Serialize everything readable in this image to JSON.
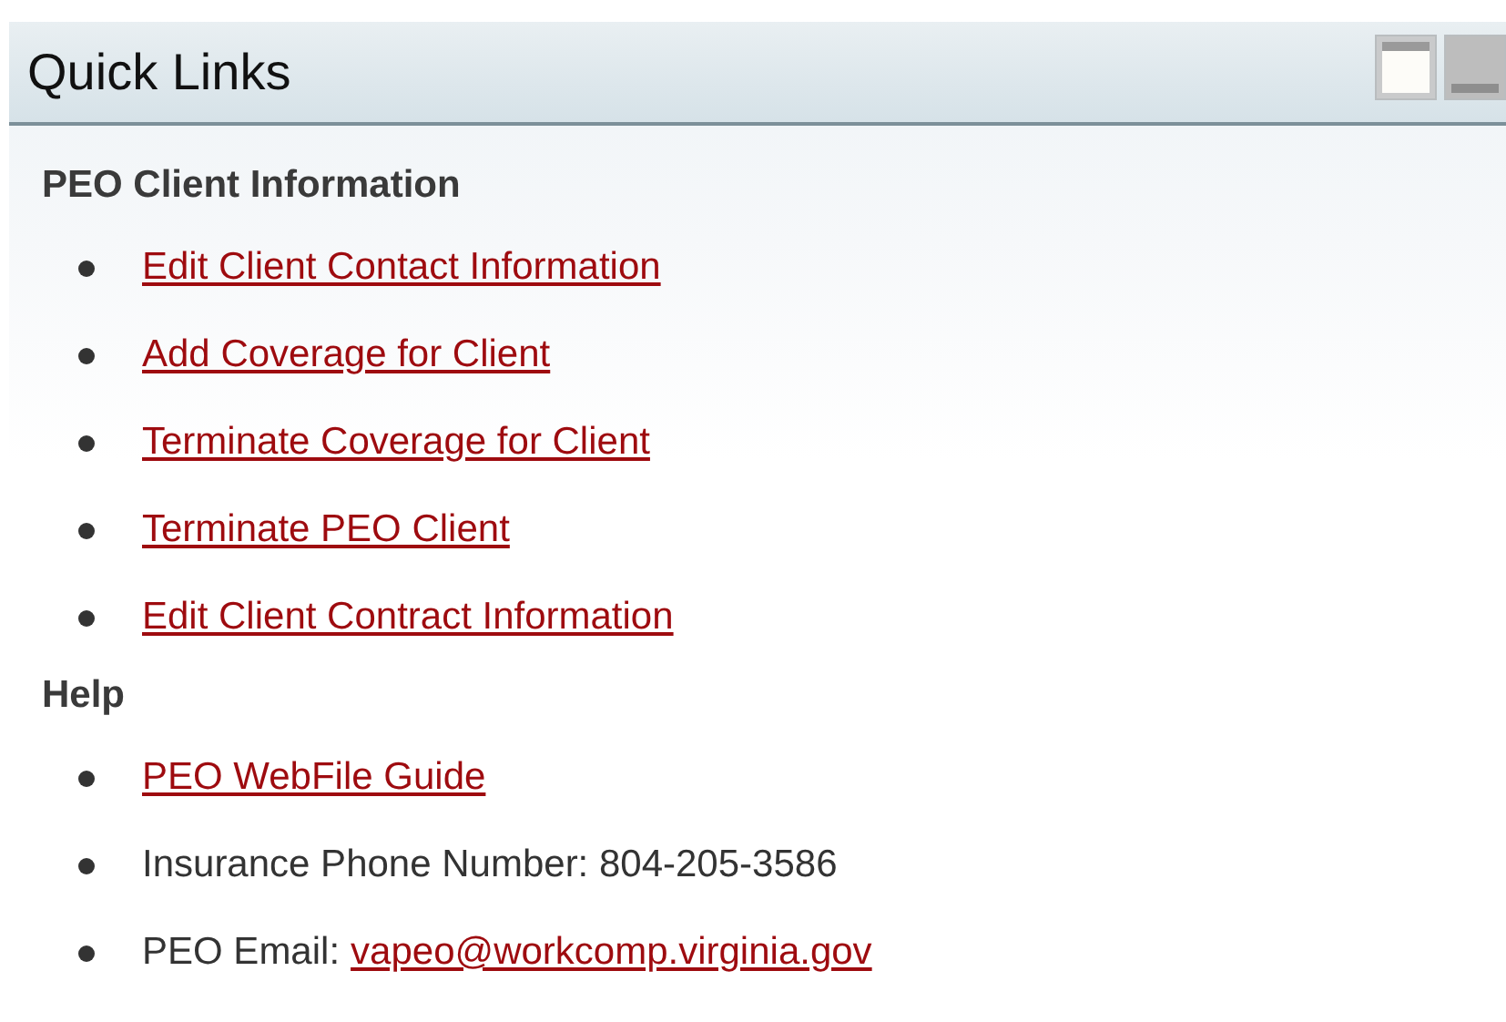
{
  "panel": {
    "title": "Quick Links"
  },
  "sections": [
    {
      "heading": "PEO Client Information",
      "items": [
        {
          "kind": "link",
          "link": "Edit Client Contact Information"
        },
        {
          "kind": "link",
          "link": "Add Coverage for Client"
        },
        {
          "kind": "link",
          "link": "Terminate Coverage for Client"
        },
        {
          "kind": "link",
          "link": "Terminate PEO Client"
        },
        {
          "kind": "link",
          "link": "Edit Client Contract Information"
        }
      ]
    },
    {
      "heading": "Help",
      "items": [
        {
          "kind": "link",
          "link": "PEO WebFile Guide"
        },
        {
          "kind": "text",
          "text": "Insurance Phone Number: 804-205-3586"
        },
        {
          "kind": "label_link",
          "text": "PEO Email:",
          "link": "vapeo@workcomp.virginia.gov"
        }
      ]
    }
  ]
}
